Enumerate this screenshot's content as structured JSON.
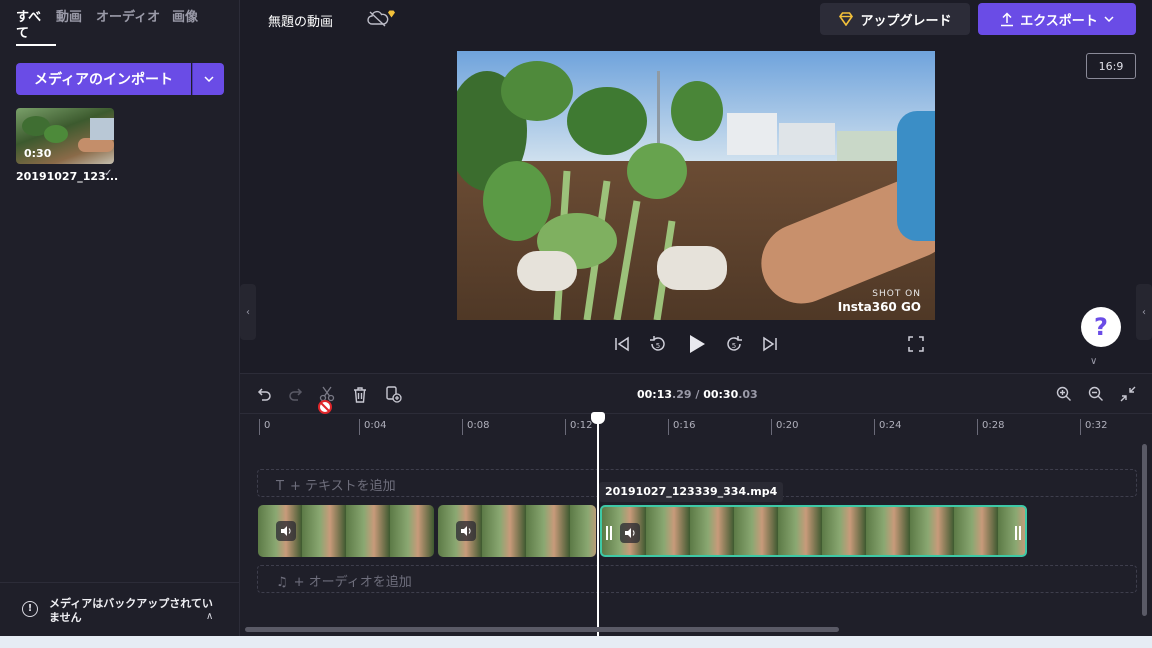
{
  "app": {
    "project_title": "無題の動画",
    "upgrade_label": "アップグレード",
    "export_label": "エクスポート",
    "aspect_ratio": "16:9",
    "accent_color": "#6a4ce6",
    "selection_color": "#3ec9a6"
  },
  "library": {
    "tabs": [
      {
        "label": "すべて",
        "active": true
      },
      {
        "label": "動画",
        "active": false
      },
      {
        "label": "オーディオ",
        "active": false
      },
      {
        "label": "画像",
        "active": false
      }
    ],
    "import_label": "メディアのインポート",
    "media": [
      {
        "name": "20191027_123...",
        "duration": "0:30"
      }
    ],
    "backup_warning": "メディアはバックアップされていません"
  },
  "preview": {
    "watermark_line1": "SHOT ON",
    "watermark_line2": "Insta360 GO"
  },
  "timeline": {
    "current_time_main": "00:13",
    "current_time_frac": ".29",
    "separator": " / ",
    "total_time_main": "00:30",
    "total_time_frac": ".03",
    "ruler_ticks": [
      "0",
      "0:04",
      "0:08",
      "0:12",
      "0:16",
      "0:20",
      "0:24",
      "0:28",
      "0:32"
    ],
    "add_text_label": "+ テキストを追加",
    "add_audio_label": "+ オーディオを追加",
    "selected_clip_name": "20191027_123339_334.mp4"
  }
}
